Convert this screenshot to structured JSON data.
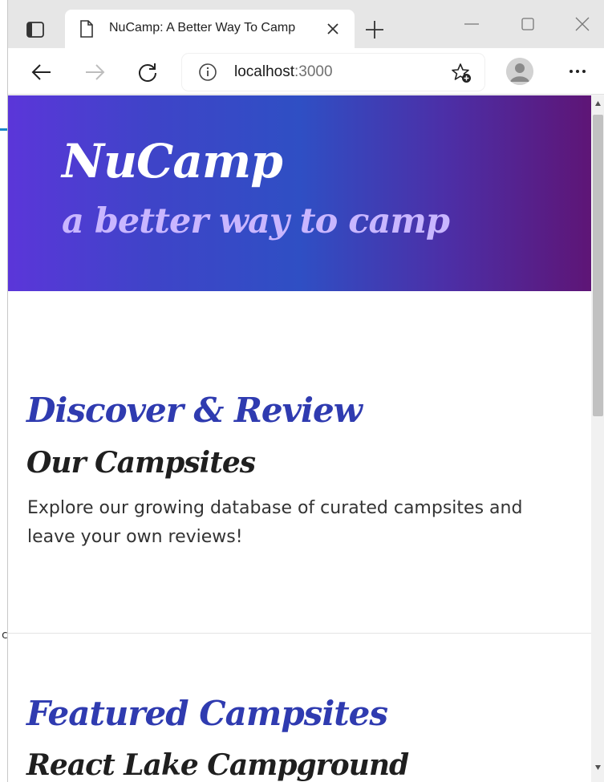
{
  "browser": {
    "tab_title": "NuCamp: A Better Way To Camp",
    "address_host": "localhost",
    "address_port": ":3000"
  },
  "icons": {
    "tab_actions": "tab-actions-icon",
    "page": "page-icon",
    "close_tab": "close-icon",
    "new_tab": "plus-icon",
    "minimize": "minimize-icon",
    "maximize": "maximize-icon",
    "close_window": "close-icon",
    "back": "arrow-left-icon",
    "forward": "arrow-right-icon",
    "refresh": "refresh-icon",
    "info": "info-icon",
    "favorite": "star-add-icon",
    "profile": "avatar-icon",
    "more": "ellipsis-icon"
  },
  "page": {
    "brand": "NuCamp",
    "tagline": "a better way to camp",
    "discover_heading": "Discover & Review",
    "campsites_heading": "Our Campsites",
    "campsites_text": "Explore our growing database of curated campsites and leave your own reviews!",
    "featured_heading": "Featured Campsites",
    "featured_name": "React Lake Campground"
  },
  "desktop": {
    "left_edge_letter": "c"
  }
}
